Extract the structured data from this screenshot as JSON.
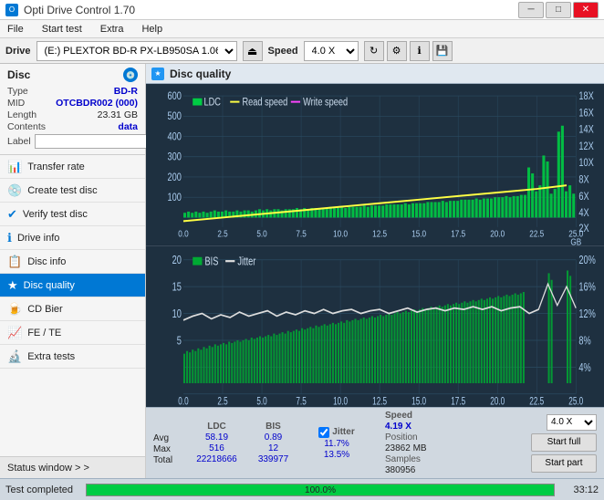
{
  "app": {
    "title": "Opti Drive Control 1.70",
    "icon": "O"
  },
  "title_bar": {
    "title": "Opti Drive Control 1.70",
    "minimize": "─",
    "maximize": "□",
    "close": "✕"
  },
  "menu": {
    "items": [
      "File",
      "Start test",
      "Extra",
      "Help"
    ]
  },
  "drive_row": {
    "label": "Drive",
    "drive_value": "(E:)  PLEXTOR BD-R  PX-LB950SA 1.06",
    "speed_label": "Speed",
    "speed_value": "4.0 X"
  },
  "disc": {
    "title": "Disc",
    "type_label": "Type",
    "type_value": "BD-R",
    "mid_label": "MID",
    "mid_value": "OTCBDR002 (000)",
    "length_label": "Length",
    "length_value": "23.31 GB",
    "contents_label": "Contents",
    "contents_value": "data",
    "label_label": "Label",
    "label_value": ""
  },
  "nav": {
    "items": [
      {
        "id": "transfer-rate",
        "label": "Transfer rate",
        "icon": "📊"
      },
      {
        "id": "create-test-disc",
        "label": "Create test disc",
        "icon": "💿"
      },
      {
        "id": "verify-test-disc",
        "label": "Verify test disc",
        "icon": "✔"
      },
      {
        "id": "drive-info",
        "label": "Drive info",
        "icon": "ℹ"
      },
      {
        "id": "disc-info",
        "label": "Disc info",
        "icon": "📋"
      },
      {
        "id": "disc-quality",
        "label": "Disc quality",
        "icon": "★",
        "active": true
      },
      {
        "id": "cd-bier",
        "label": "CD Bier",
        "icon": "🍺"
      },
      {
        "id": "fe-te",
        "label": "FE / TE",
        "icon": "📈"
      },
      {
        "id": "extra-tests",
        "label": "Extra tests",
        "icon": "🔬"
      }
    ],
    "status_window": "Status window > >"
  },
  "disc_quality": {
    "title": "Disc quality",
    "legend": {
      "ldc": "LDC",
      "read_speed": "Read speed",
      "write_speed": "Write speed",
      "bis": "BIS",
      "jitter": "Jitter"
    },
    "chart_top": {
      "y_max": 600,
      "y_right_max": 18,
      "x_max": 25,
      "x_label": "GB",
      "y_ticks_left": [
        600,
        500,
        400,
        300,
        200,
        100
      ],
      "y_ticks_right": [
        18,
        16,
        14,
        12,
        10,
        8,
        6,
        4,
        2
      ],
      "x_ticks": [
        0.0,
        2.5,
        5.0,
        7.5,
        10.0,
        12.5,
        15.0,
        17.5,
        20.0,
        22.5,
        25.0
      ]
    },
    "chart_bottom": {
      "y_max": 20,
      "y_right_max": 20,
      "x_max": 25,
      "x_label": "GB",
      "y_ticks_left": [
        20,
        15,
        10,
        5
      ],
      "y_ticks_right": [
        "20%",
        "16%",
        "12%",
        "8%",
        "4%"
      ],
      "x_ticks": [
        0.0,
        2.5,
        5.0,
        7.5,
        10.0,
        12.5,
        15.0,
        17.5,
        20.0,
        22.5,
        25.0
      ]
    }
  },
  "stats": {
    "columns": {
      "ldc_label": "LDC",
      "bis_label": "BIS",
      "jitter_label": "Jitter",
      "speed_label": "Speed",
      "speed_val": "4.19 X"
    },
    "rows": {
      "avg_label": "Avg",
      "avg_ldc": "58.19",
      "avg_bis": "0.89",
      "avg_jitter": "11.7%",
      "max_label": "Max",
      "max_ldc": "516",
      "max_bis": "12",
      "max_jitter": "13.5%",
      "position_label": "Position",
      "position_val": "23862 MB",
      "total_label": "Total",
      "total_ldc": "22218666",
      "total_bis": "339977",
      "samples_label": "Samples",
      "samples_val": "380956"
    },
    "speed_select": "4.0 X",
    "start_full": "Start full",
    "start_part": "Start part"
  },
  "bottom": {
    "status_text": "Test completed",
    "progress_pct": "100.0%",
    "time": "33:12"
  }
}
